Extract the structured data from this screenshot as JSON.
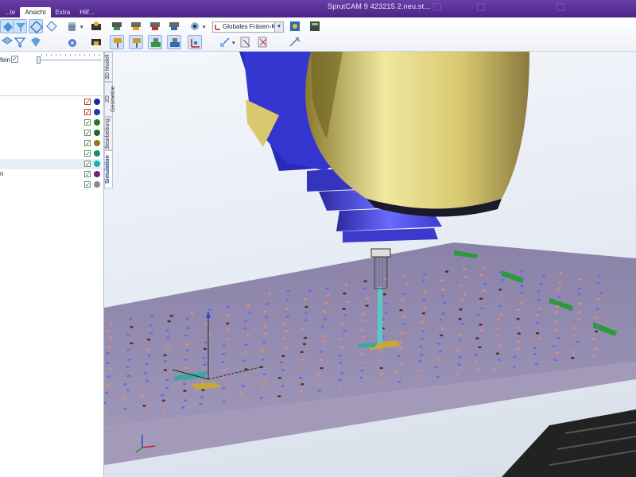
{
  "titlebar": {
    "tabs": [
      "...te",
      "Ansicht",
      "Extra",
      "Hilf..."
    ],
    "active_tab": "Ansicht",
    "title": "SprutCAM 9  423215 2.neu.st..."
  },
  "ribbon": {
    "coordinate_system": "Globales Fräsen-KS"
  },
  "left_panel": {
    "fein_label": "fein",
    "fein_checked": "✓",
    "rows": [
      {
        "label": "",
        "check": "✓",
        "color": "#1e2a9a"
      },
      {
        "label": "",
        "check": "✓",
        "color": "#1e3c9a"
      },
      {
        "label": "",
        "check": "✓",
        "color": "#1e7a2a"
      },
      {
        "label": "",
        "check": "✓",
        "color": "#1e6a2a"
      },
      {
        "label": "",
        "check": "✓",
        "color": "#8a7a1a"
      },
      {
        "label": "",
        "check": "✓",
        "color": "#1a8a7a"
      },
      {
        "label": "",
        "check": "✓",
        "color": "#1ab0b0"
      },
      {
        "label": "n",
        "check": "✓",
        "color": "#7a1a7a"
      },
      {
        "label": "",
        "check": "✓",
        "color": "#888888"
      }
    ]
  },
  "vertical_tabs": [
    "3D Modell",
    "2D Geometrie",
    "Bearbeitung",
    "Simulation"
  ],
  "active_vertical_tab": "Simulation"
}
